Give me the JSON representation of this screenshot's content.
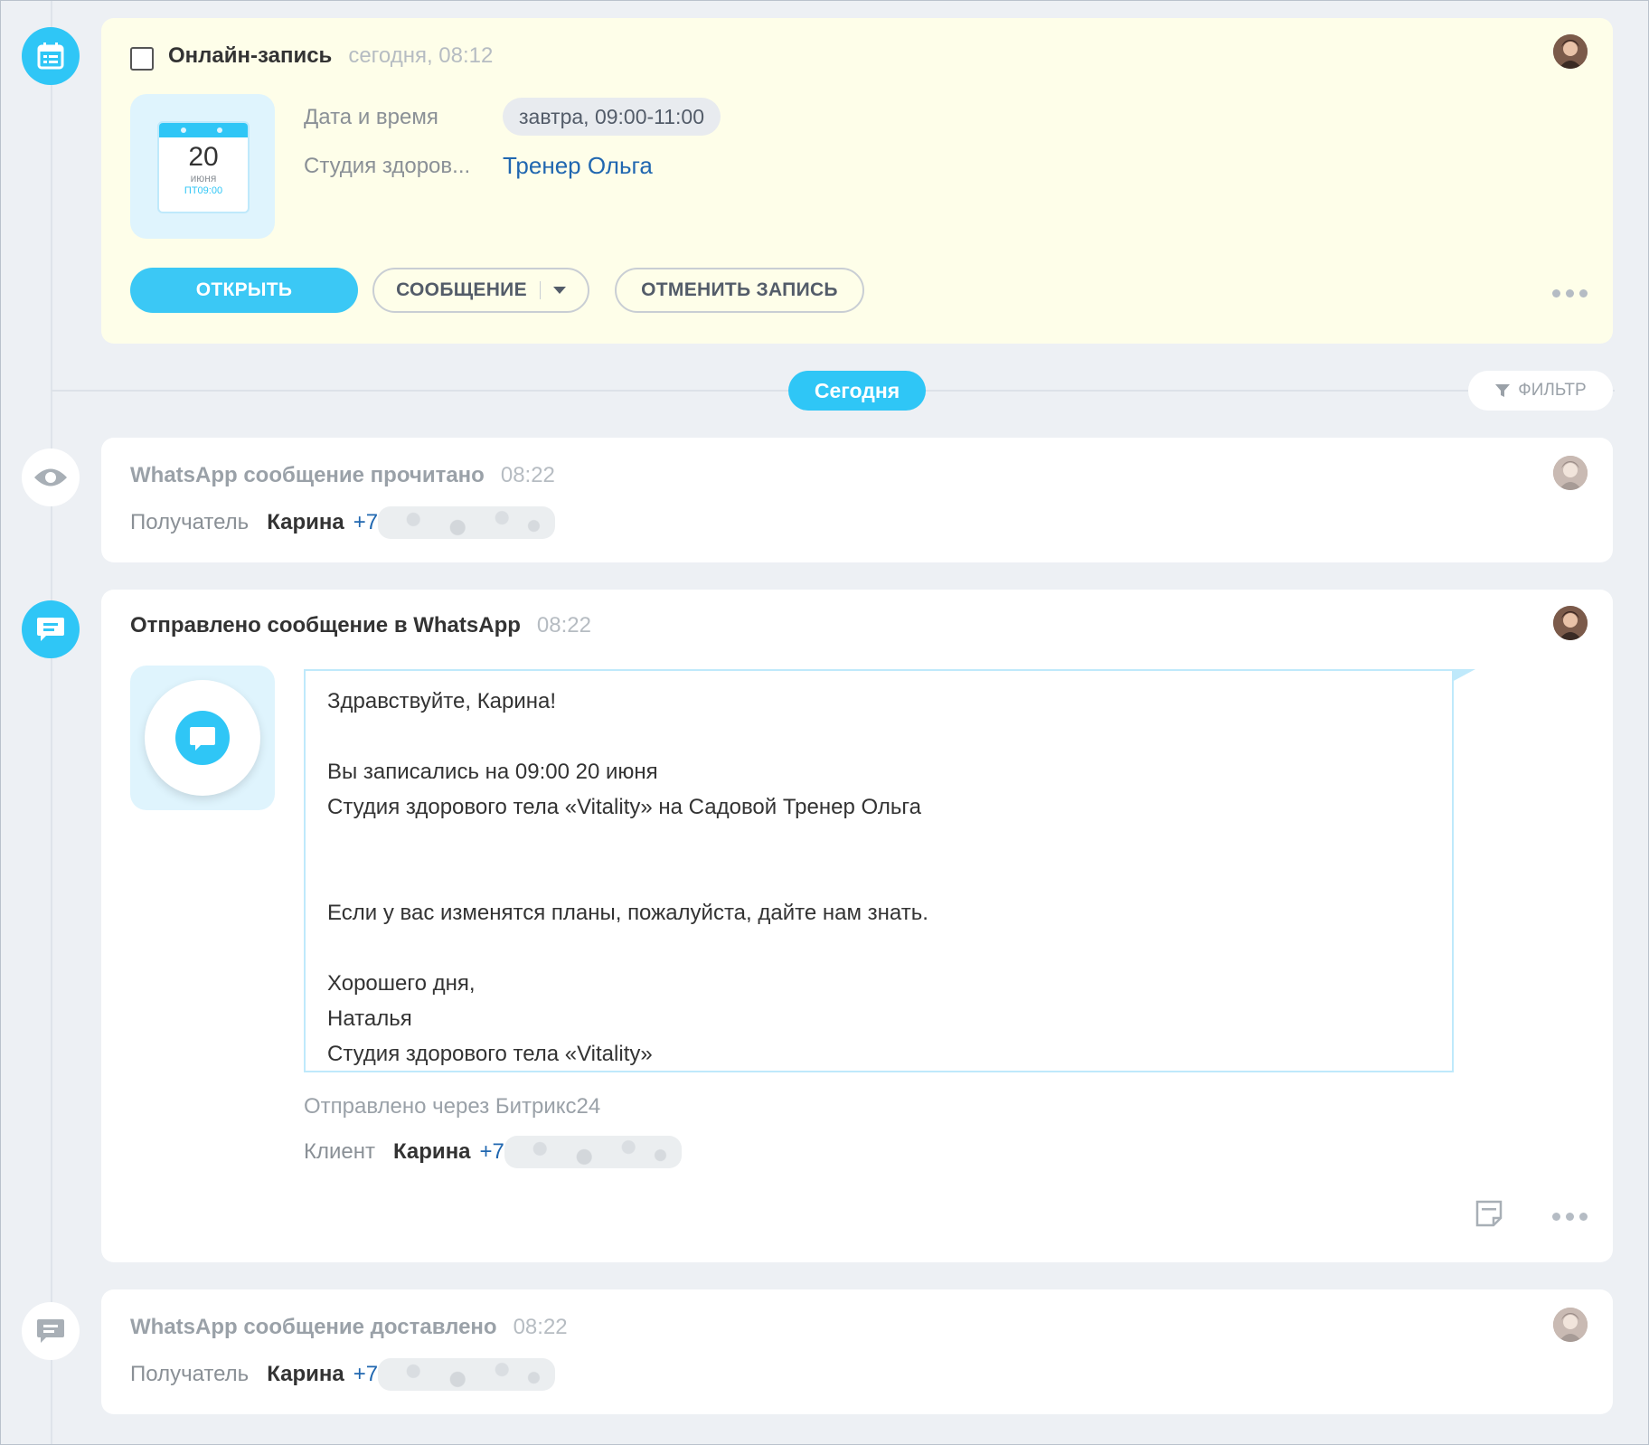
{
  "booking": {
    "title": "Онлайн-запись",
    "time": "сегодня, 08:12",
    "calendar": {
      "day": "20",
      "month": "июня",
      "dow": "ПТ09:00"
    },
    "date_label": "Дата и время",
    "date_value": "завтра, 09:00-11:00",
    "studio_label": "Студия здоров...",
    "studio_value": "Тренер Ольга",
    "buttons": {
      "open": "ОТКРЫТЬ",
      "message": "СООБЩЕНИЕ",
      "cancel": "ОТМЕНИТЬ ЗАПИСЬ"
    }
  },
  "divider": {
    "today": "Сегодня",
    "filter": "ФИЛЬТР"
  },
  "read_event": {
    "title": "WhatsApp сообщение прочитано",
    "time": "08:22",
    "recipient_label": "Получатель",
    "name": "Карина",
    "phone": "+7"
  },
  "sent_event": {
    "title": "Отправлено сообщение в WhatsApp",
    "time": "08:22",
    "message_lines": [
      "Здравствуйте, Карина!",
      "",
      "Вы записались на 09:00 20 июня",
      "Студия здорового тела «Vitality» на Садовой Тренер Ольга",
      "",
      "",
      "Если у вас изменятся планы, пожалуйста, дайте нам знать.",
      "",
      "Хорошего дня,",
      "Наталья",
      "Студия здорового тела «Vitality»"
    ],
    "sent_via": "Отправлено через Битрикс24",
    "client_label": "Клиент",
    "name": "Карина",
    "phone": "+7"
  },
  "delivered_event": {
    "title": "WhatsApp сообщение доставлено",
    "time": "08:22",
    "recipient_label": "Получатель",
    "name": "Карина",
    "phone": "+7"
  },
  "colors": {
    "accent": "#2fc6f6",
    "link": "#2067b0",
    "booking_bg": "#fefee9",
    "page_bg": "#edf0f4"
  },
  "icons": [
    "calendar-icon",
    "eye-icon",
    "chat-icon",
    "filter-icon",
    "note-icon",
    "more-icon",
    "avatar"
  ]
}
